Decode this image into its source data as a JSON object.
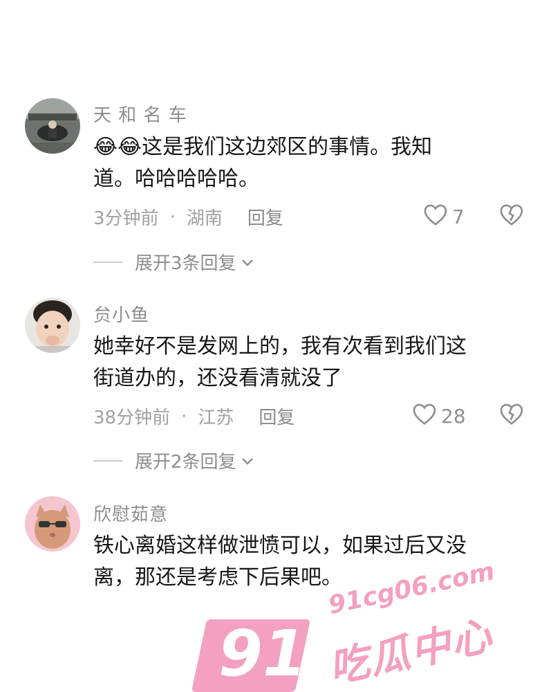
{
  "comments": [
    {
      "username": "天 和 名 车",
      "text_line1": "😂😂这是我们这边郊区的事情。我知",
      "text_line2": "道。哈哈哈哈哈。",
      "time": "3分钟前",
      "location": "湖南",
      "reply_label": "回复",
      "likes": "7",
      "expand_label": "展开3条回复"
    },
    {
      "username": "贠小鱼",
      "text_line1": "她幸好不是发网上的，我有次看到我们这",
      "text_line2": "街道办的，还没看清就没了",
      "time": "38分钟前",
      "location": "江苏",
      "reply_label": "回复",
      "likes": "28",
      "expand_label": "展开2条回复"
    },
    {
      "username": "欣慰茹意",
      "text_line1": "铁心离婚这样做泄愤可以，如果过后又没",
      "text_line2": "离，那还是考虑下后果吧。"
    }
  ],
  "meta_separator": "·",
  "watermark": {
    "number": "91",
    "url": "91cg06.com",
    "name": "吃瓜中心"
  },
  "colors": {
    "watermark_pink": "#f4a0c0",
    "meta_gray": "#a0a0a0"
  },
  "icons": {
    "like": "heart-outline-icon",
    "dislike": "broken-heart-icon",
    "expand": "chevron-down-icon"
  }
}
